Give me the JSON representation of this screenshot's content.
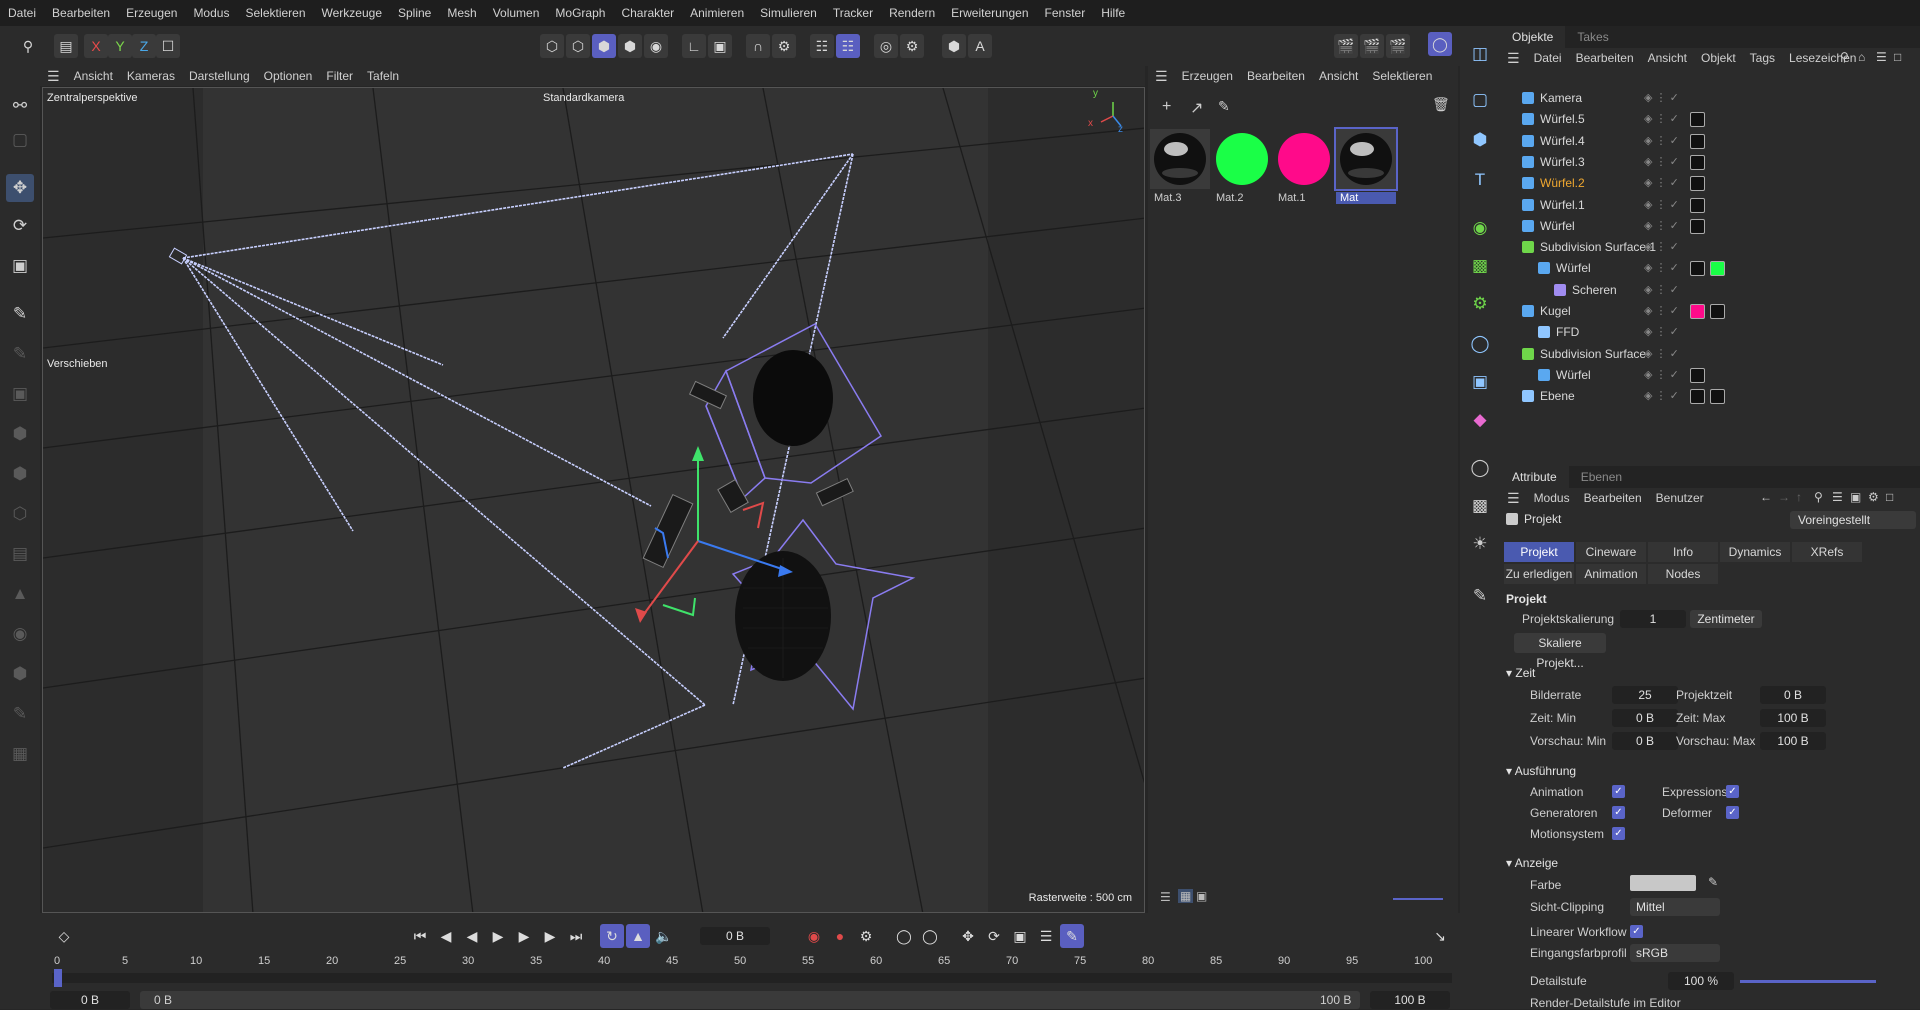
{
  "menubar": [
    "Datei",
    "Bearbeiten",
    "Erzeugen",
    "Modus",
    "Selektieren",
    "Werkzeuge",
    "Spline",
    "Mesh",
    "Volumen",
    "MoGraph",
    "Charakter",
    "Animieren",
    "Simulieren",
    "Tracker",
    "Rendern",
    "Erweiterungen",
    "Fenster",
    "Hilfe"
  ],
  "toolbar": {
    "x": "X",
    "y": "Y",
    "z": "Z"
  },
  "viewport": {
    "menu": [
      "Ansicht",
      "Kameras",
      "Darstellung",
      "Optionen",
      "Filter",
      "Tafeln"
    ],
    "perspective": "Zentralperspektive",
    "camera": "Standardkamera",
    "tool": "Verschieben",
    "status": "Rasterweite : 500 cm",
    "axis_x": "x",
    "axis_y": "y",
    "axis_z": "z"
  },
  "materials": {
    "menu": [
      "Erzeugen",
      "Bearbeiten",
      "Ansicht",
      "Selektieren"
    ],
    "items": [
      {
        "label": "Mat.3",
        "color": "#101010"
      },
      {
        "label": "Mat.2",
        "color": "#1aff47"
      },
      {
        "label": "Mat.1",
        "color": "#ff0a8a"
      },
      {
        "label": "Mat",
        "color": "#101010"
      }
    ]
  },
  "objects": {
    "tabs": [
      "Objekte",
      "Takes"
    ],
    "menu": [
      "Datei",
      "Bearbeiten",
      "Ansicht",
      "Objekt",
      "Tags",
      "Lesezeichen"
    ],
    "rows": [
      {
        "name": "Kamera",
        "indent": 0
      },
      {
        "name": "Würfel.5",
        "indent": 0
      },
      {
        "name": "Würfel.4",
        "indent": 0
      },
      {
        "name": "Würfel.3",
        "indent": 0
      },
      {
        "name": "Würfel.2",
        "indent": 0,
        "selected": true
      },
      {
        "name": "Würfel.1",
        "indent": 0
      },
      {
        "name": "Würfel",
        "indent": 0
      },
      {
        "name": "Subdivision Surface.1",
        "indent": 0
      },
      {
        "name": "Würfel",
        "indent": 1
      },
      {
        "name": "Scheren",
        "indent": 2
      },
      {
        "name": "Kugel",
        "indent": 0
      },
      {
        "name": "FFD",
        "indent": 1
      },
      {
        "name": "Subdivision Surface",
        "indent": 0
      },
      {
        "name": "Würfel",
        "indent": 1
      },
      {
        "name": "Ebene",
        "indent": 0
      }
    ]
  },
  "attributes": {
    "tabs": [
      "Attribute",
      "Ebenen"
    ],
    "menu": [
      "Modus",
      "Bearbeiten",
      "Benutzer"
    ],
    "title": "Projekt",
    "preset": "Voreingestellt",
    "subtabs": [
      "Projekt",
      "Cineware",
      "Info",
      "Dynamics",
      "XRefs",
      "Zu erledigen",
      "Animation",
      "Nodes"
    ],
    "section_projekt": "Projekt",
    "projektskalierung_label": "Projektskalierung",
    "projektskalierung_value": "1",
    "projektskalierung_unit": "Zentimeter",
    "skaliere_button": "Skaliere Projekt...",
    "section_zeit": "Zeit",
    "bilderrate_label": "Bilderrate",
    "bilderrate": "25",
    "projektzeit_label": "Projektzeit",
    "projektzeit": "0 B",
    "zeitmin_label": "Zeit: Min",
    "zeitmin": "0 B",
    "zeitmax_label": "Zeit: Max",
    "zeitmax": "100 B",
    "vorschaumin_label": "Vorschau: Min",
    "vorschaumin": "0 B",
    "vorschaumax_label": "Vorschau: Max",
    "vorschaumax": "100 B",
    "section_ausfuehrung": "Ausführung",
    "animation": "Animation",
    "expressions": "Expressions",
    "generatoren": "Generatoren",
    "deformer": "Deformer",
    "motionsystem": "Motionsystem",
    "section_anzeige": "Anzeige",
    "farbe": "Farbe",
    "sichtclipping_label": "Sicht-Clipping",
    "sichtclipping": "Mittel",
    "linearer": "Linearer Workflow",
    "eingang_label": "Eingangsfarbprofil",
    "eingang": "sRGB",
    "detail_label": "Detailstufe",
    "detail": "100 %",
    "renderdetail": "Render-Detailstufe im Editor"
  },
  "timeline": {
    "frame": "0 B",
    "ticks": [
      "0",
      "5",
      "10",
      "15",
      "20",
      "25",
      "30",
      "35",
      "40",
      "45",
      "50",
      "55",
      "60",
      "65",
      "70",
      "75",
      "80",
      "85",
      "90",
      "95",
      "100"
    ],
    "start": "0 B",
    "range_start": "0 B",
    "range_end": "100 B",
    "end": "100 B"
  }
}
